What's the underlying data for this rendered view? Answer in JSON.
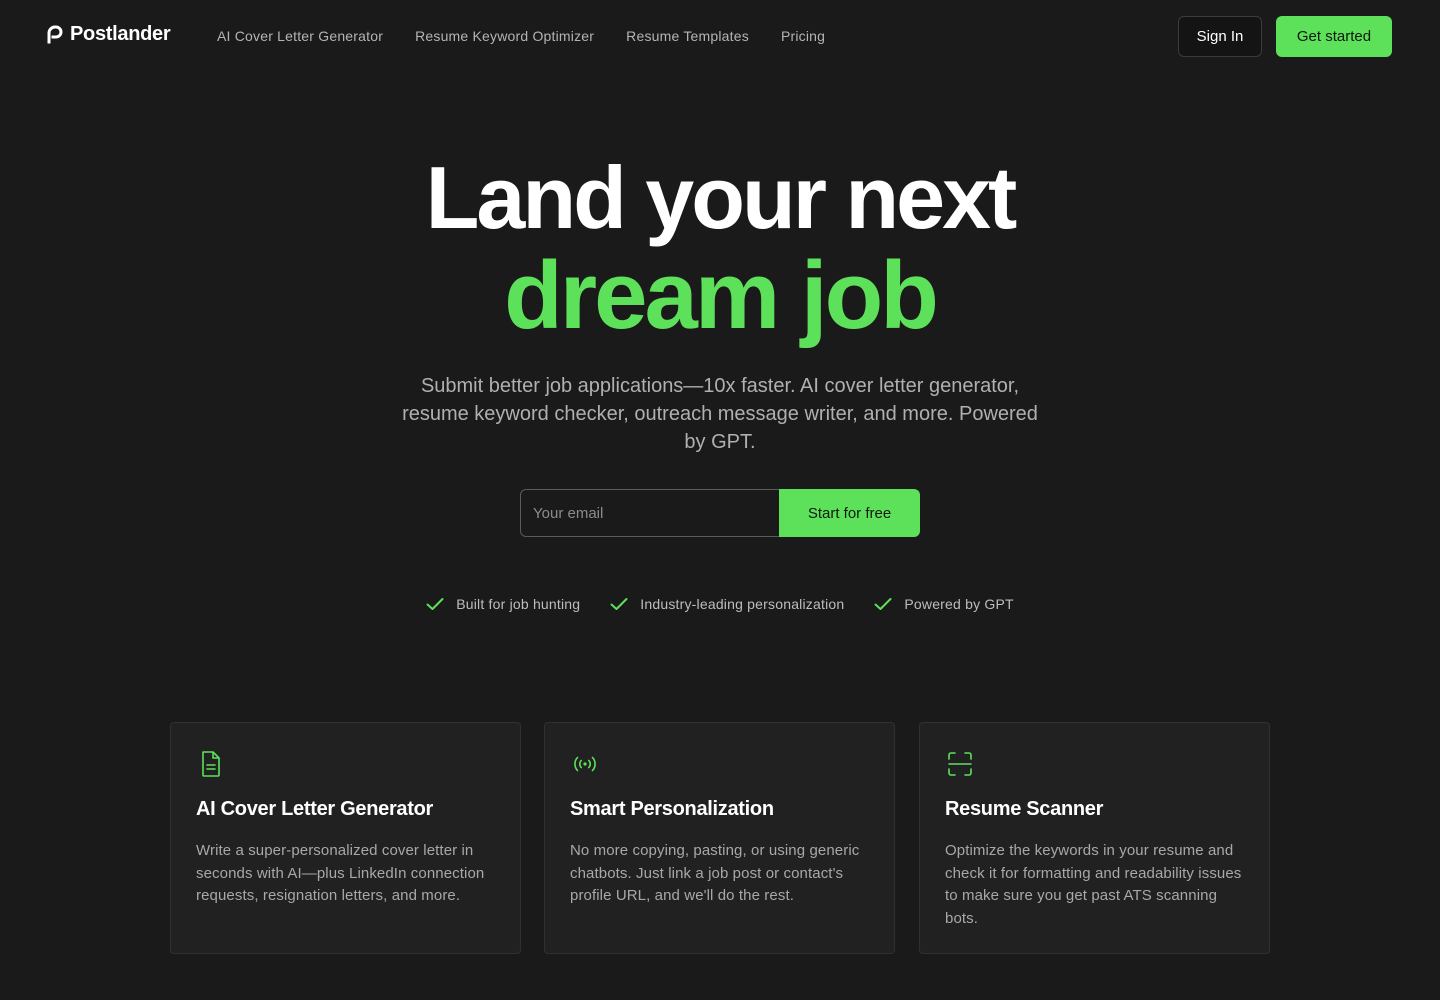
{
  "brand": {
    "name": "Postlander",
    "accent_color": "#5ee15a",
    "background_color": "#1a1a1a"
  },
  "nav": {
    "links": [
      "AI Cover Letter Generator",
      "Resume Keyword Optimizer",
      "Resume Templates",
      "Pricing"
    ],
    "sign_in_label": "Sign In",
    "get_started_label": "Get started"
  },
  "hero": {
    "title_line1": "Land your next",
    "title_line2": "dream job",
    "subtitle": "Submit better job applications—10x faster. AI cover letter generator, resume keyword checker, outreach message writer, and more. Powered by GPT."
  },
  "signup": {
    "email_placeholder": "Your email",
    "email_value": "",
    "submit_label": "Start for free"
  },
  "highlights": [
    {
      "icon": "check-icon",
      "label": "Built for job hunting"
    },
    {
      "icon": "check-icon",
      "label": "Industry-leading personalization"
    },
    {
      "icon": "check-icon",
      "label": "Powered by GPT"
    }
  ],
  "features": [
    {
      "icon": "document-icon",
      "title": "AI Cover Letter Generator",
      "body": "Write a super-personalized cover letter in seconds with AI—plus LinkedIn connection requests, resignation letters, and more."
    },
    {
      "icon": "broadcast-icon",
      "title": "Smart Personalization",
      "body": "No more copying, pasting, or using generic chatbots. Just link a job post or contact's profile URL, and we'll do the rest."
    },
    {
      "icon": "scan-icon",
      "title": "Resume Scanner",
      "body": "Optimize the keywords in your resume and check it for formatting and readability issues to make sure you get past ATS scanning bots."
    }
  ]
}
